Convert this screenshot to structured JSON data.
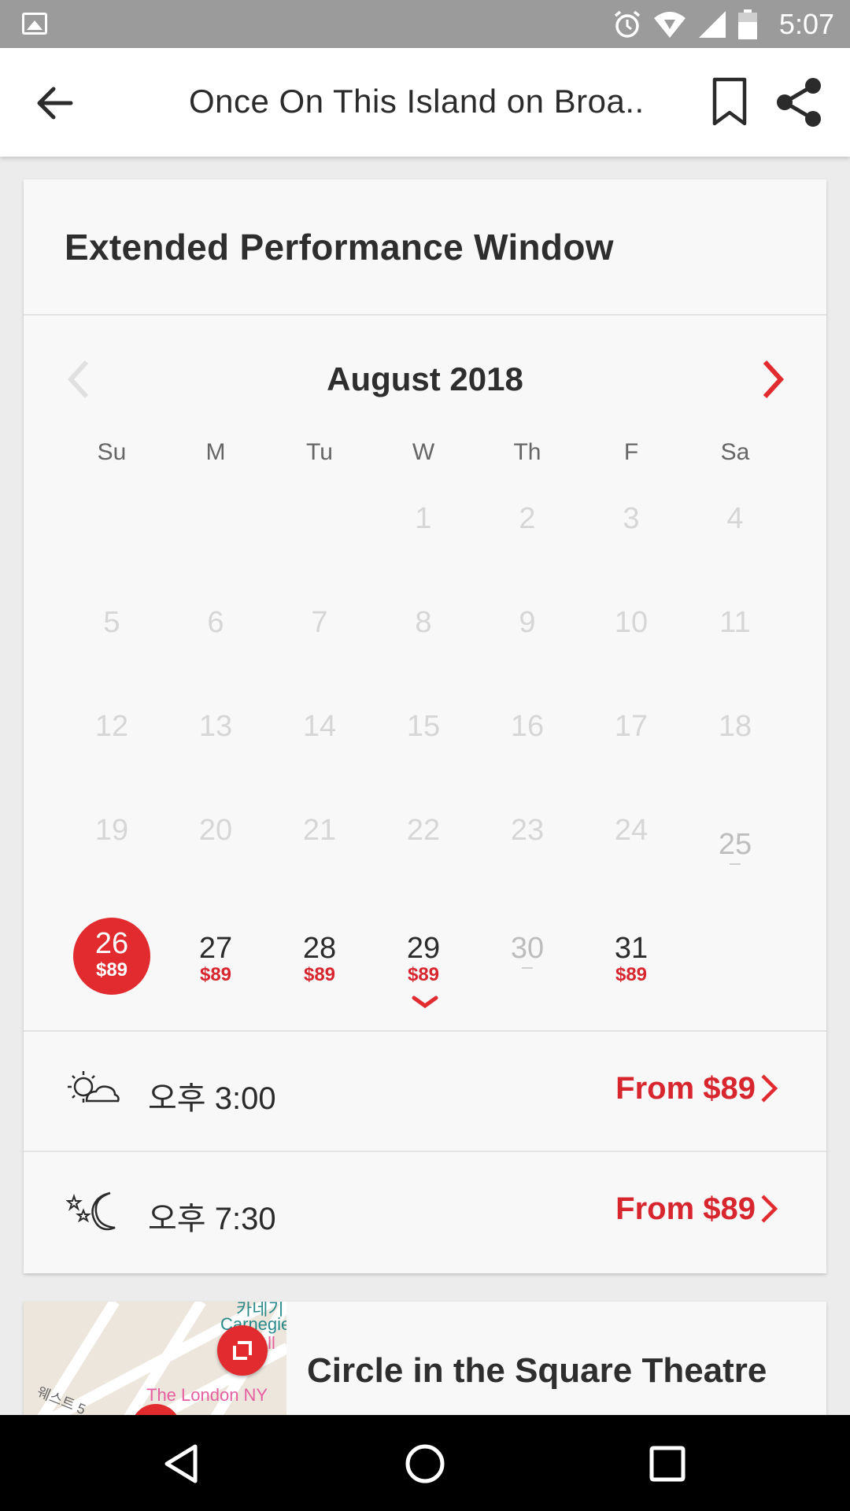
{
  "status_bar": {
    "time": "5:07",
    "icons": [
      "image-icon",
      "alarm-icon",
      "wifi-icon",
      "signal-icon",
      "battery-icon"
    ]
  },
  "app_bar": {
    "title": "Once On This Island on Broa..",
    "icons": [
      "back-arrow-icon",
      "bookmark-icon",
      "share-icon"
    ]
  },
  "card": {
    "heading": "Extended Performance Window",
    "calendar": {
      "month": "August 2018",
      "weekdays": [
        "Su",
        "M",
        "Tu",
        "W",
        "Th",
        "F",
        "Sa"
      ],
      "rows": [
        [
          "",
          "",
          "",
          "1",
          "2",
          "3",
          "4"
        ],
        [
          "5",
          "6",
          "7",
          "8",
          "9",
          "10",
          "11"
        ],
        [
          "12",
          "13",
          "14",
          "15",
          "16",
          "17",
          "18"
        ],
        [
          "19",
          "20",
          "21",
          "22",
          "23",
          "24",
          "25"
        ]
      ],
      "last_row": [
        {
          "day": "26",
          "price": "$89"
        },
        {
          "day": "27",
          "price": "$89"
        },
        {
          "day": "28",
          "price": "$89"
        },
        {
          "day": "29",
          "price": "$89"
        },
        {
          "day": "30",
          "price": ""
        },
        {
          "day": "31",
          "price": "$89"
        }
      ],
      "selected_day": "26"
    },
    "showtimes": [
      {
        "icon": "sun-cloud-icon",
        "time": "오후 3:00",
        "from": "From $89"
      },
      {
        "icon": "moon-stars-icon",
        "time": "오후 7:30",
        "from": "From $89"
      }
    ]
  },
  "venue": {
    "name": "Circle in the Square Theatre",
    "map_labels": [
      "카네기",
      "Carnegie",
      "Hall",
      "The London NY",
      "웨스트 5"
    ]
  },
  "colors": {
    "accent": "#e12b2f",
    "price_red": "#d7262e",
    "status_bar": "#9b9b9b"
  }
}
